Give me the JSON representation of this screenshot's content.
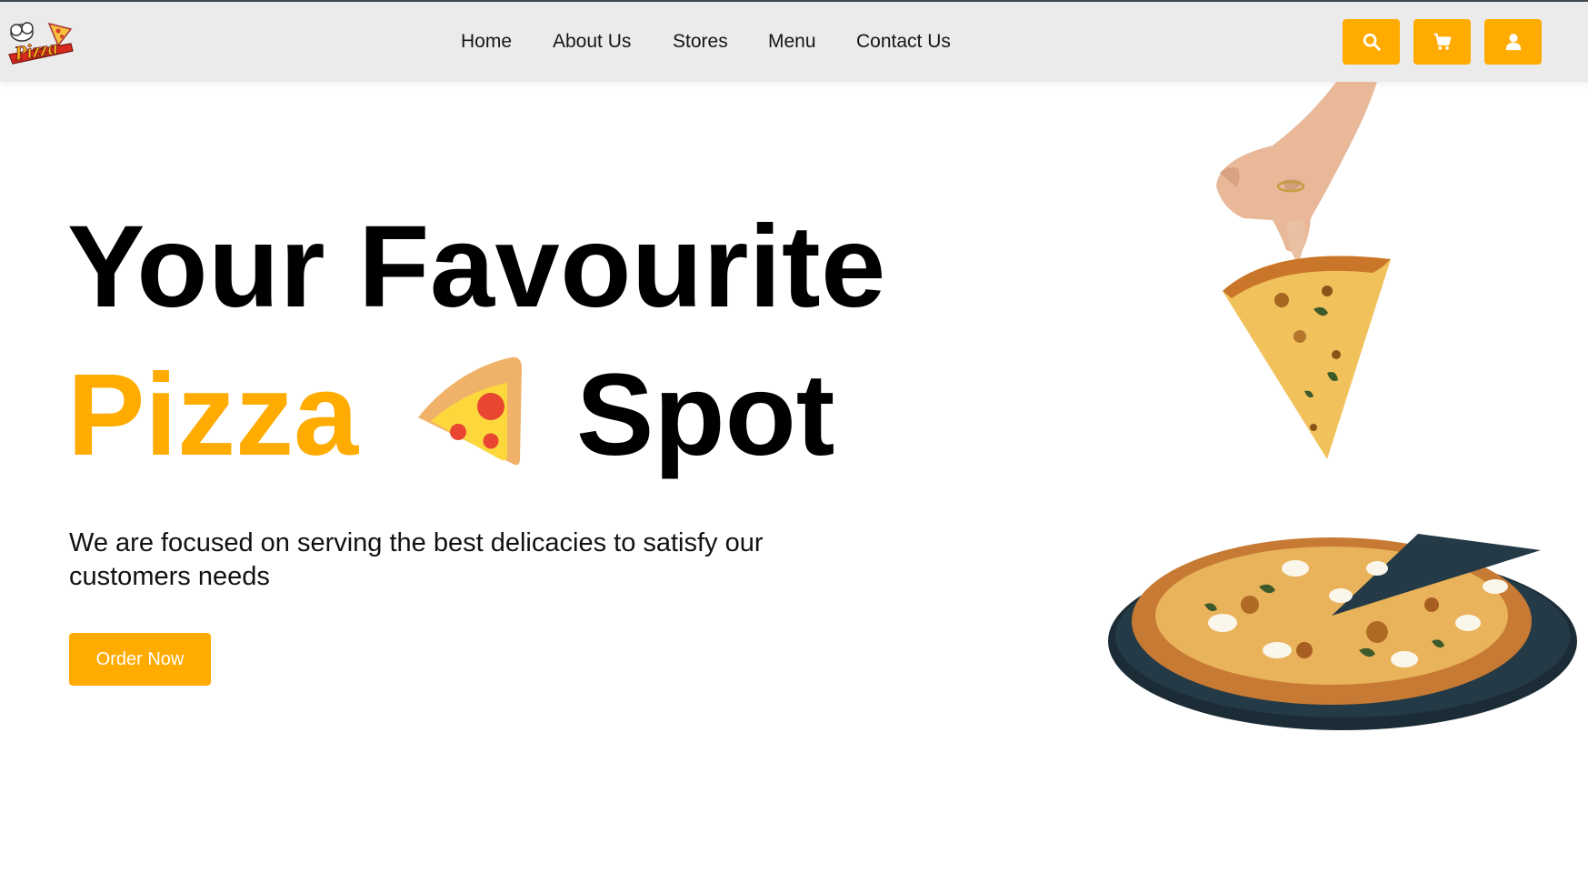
{
  "nav": {
    "links": [
      "Home",
      "About Us",
      "Stores",
      "Menu",
      "Contact Us"
    ],
    "icons": [
      "search-icon",
      "cart-icon",
      "user-icon"
    ]
  },
  "hero": {
    "title_line1": "Your Favourite",
    "title_pizza": "Pizza",
    "title_spot": "Spot",
    "subtitle": "We are focused on serving the best delicacies to satisfy our customers needs",
    "order_button": "Order Now"
  },
  "colors": {
    "accent": "#ffab00",
    "nav_bg": "#ebebeb",
    "text": "#000000"
  }
}
